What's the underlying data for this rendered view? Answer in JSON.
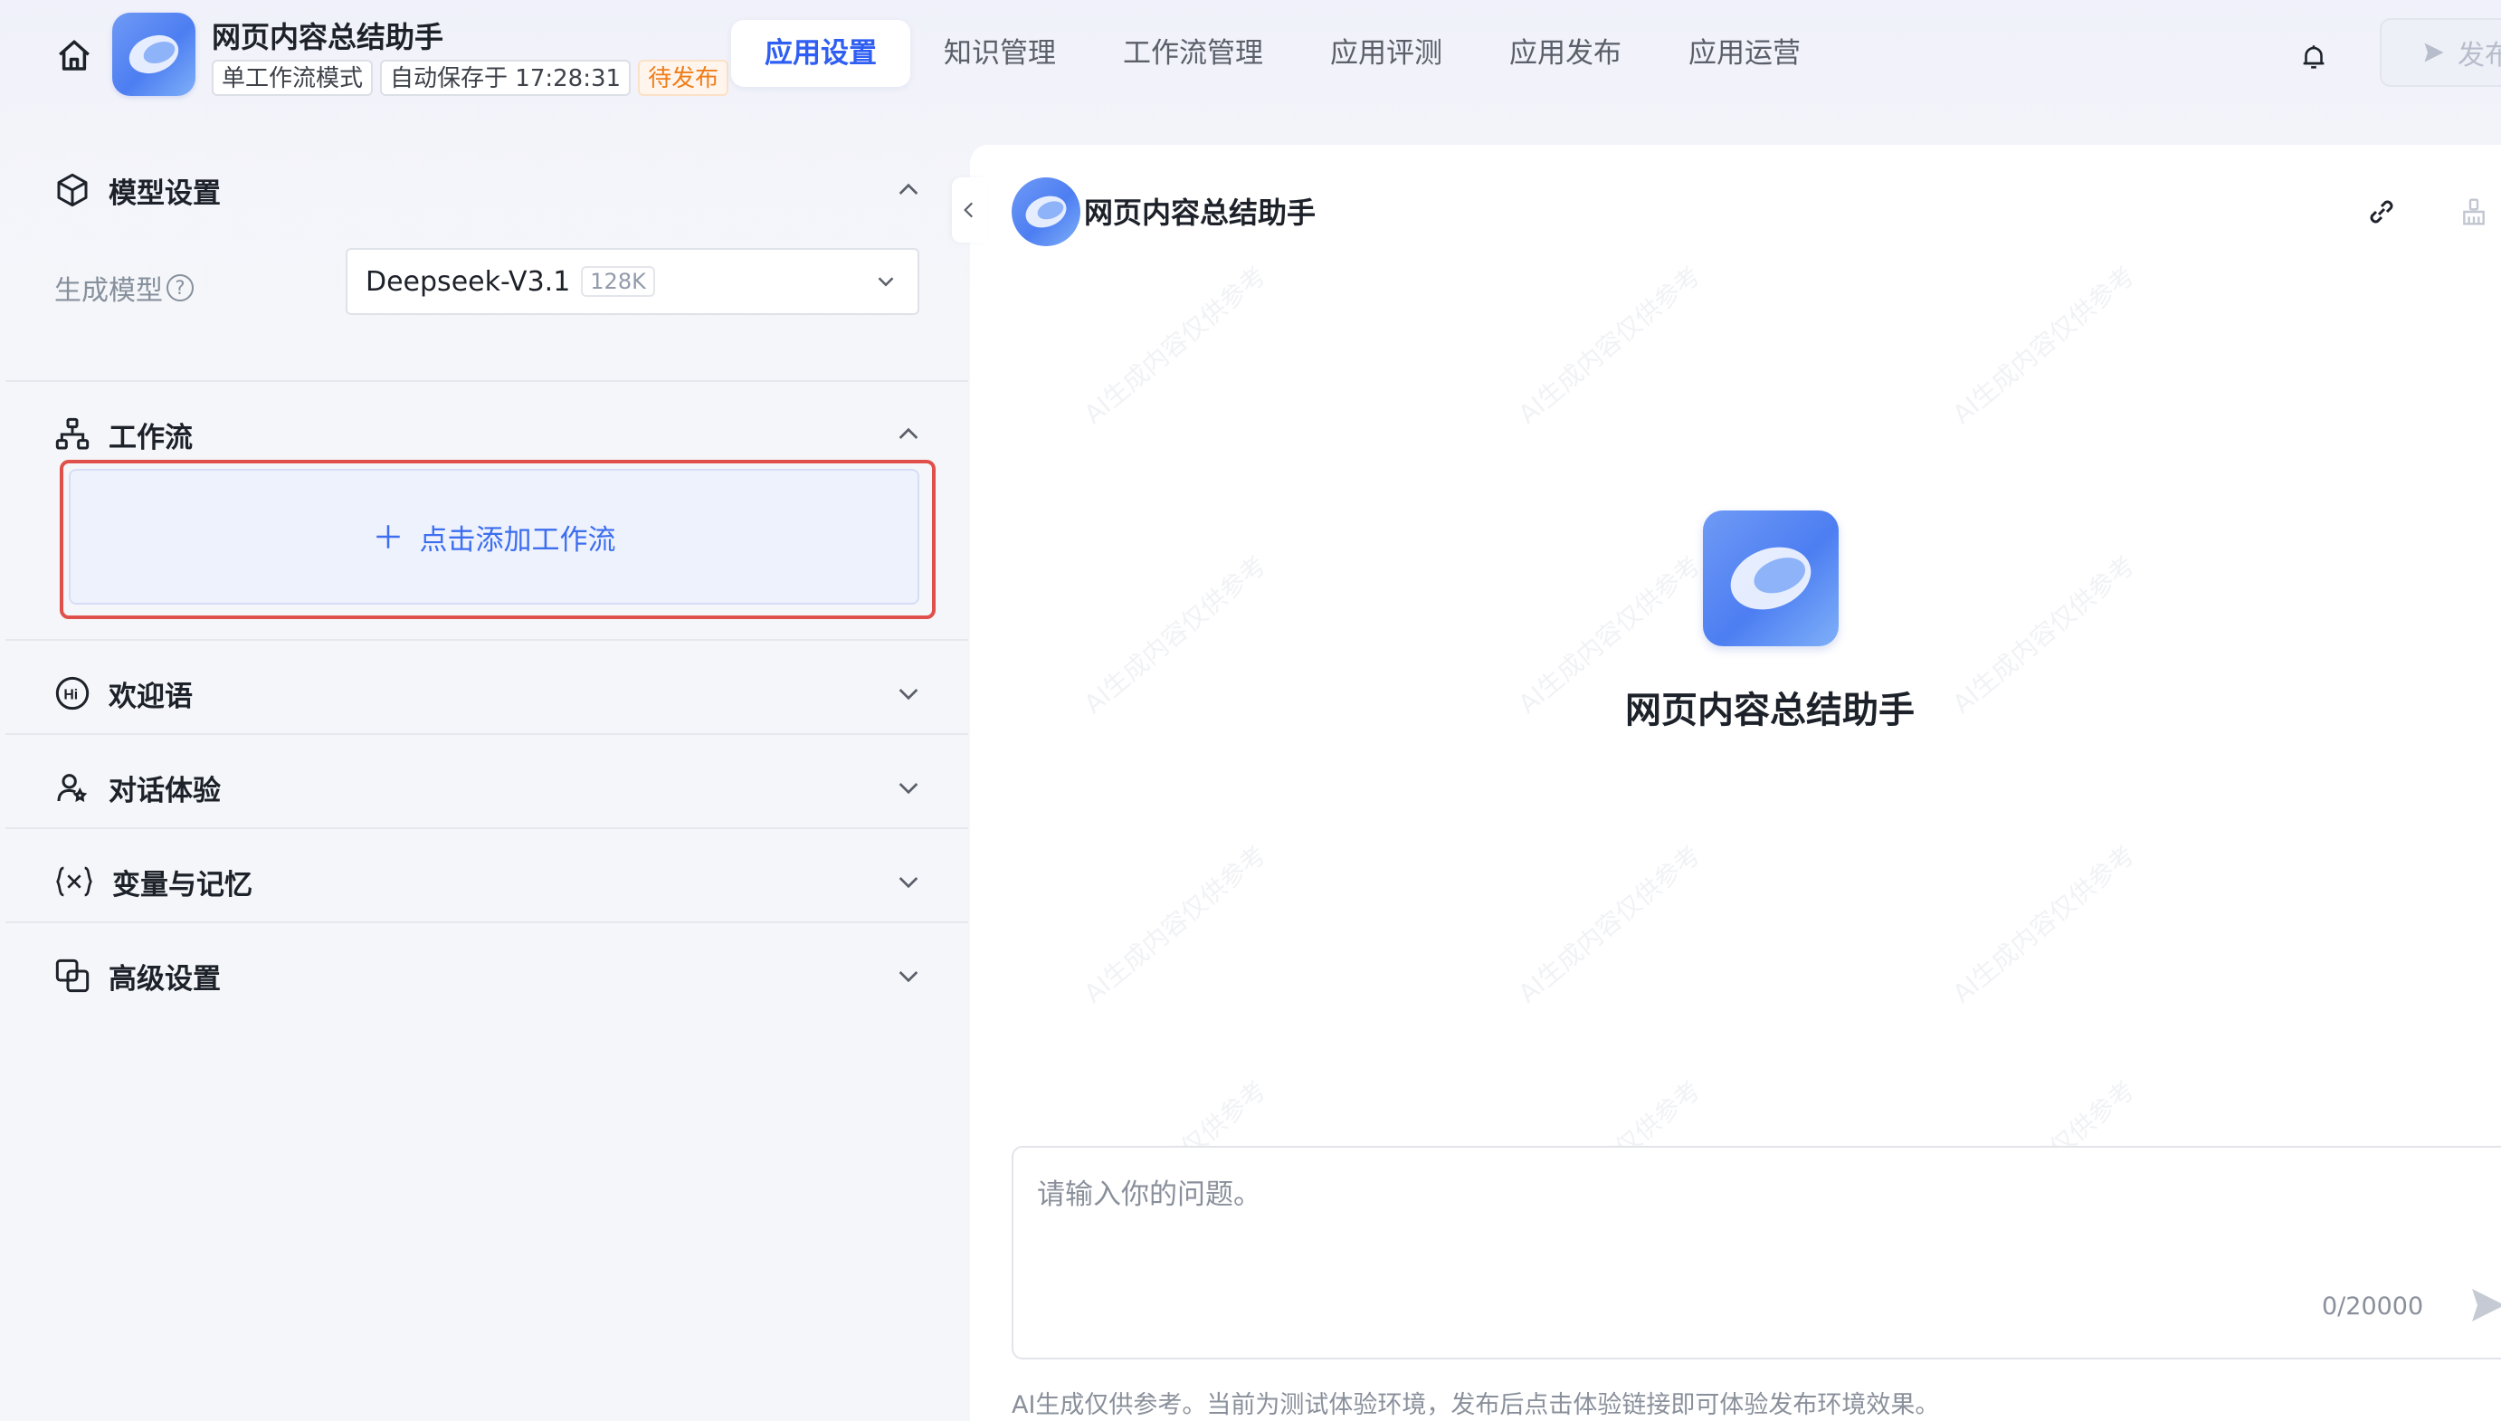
{
  "header": {
    "app_name": "网页内容总结助手",
    "tags": {
      "mode": "单工作流模式",
      "autosave": "自动保存于 17:28:31",
      "status": "待发布"
    },
    "nav_tabs": [
      "应用设置",
      "知识管理",
      "工作流管理",
      "应用评测",
      "应用发布",
      "应用运营"
    ],
    "active_tab": "应用设置",
    "publish_label": "发布"
  },
  "left": {
    "model_section": {
      "title": "模型设置",
      "gen_model_label": "生成模型",
      "help_glyph": "?",
      "model_name": "Deepseek-V3.1",
      "context": "128K"
    },
    "workflow_section": {
      "title": "工作流",
      "add_label": "点击添加工作流"
    },
    "sections": [
      {
        "title": "欢迎语",
        "icon": "hi-icon"
      },
      {
        "title": "对话体验",
        "icon": "user-chat-icon"
      },
      {
        "title": "变量与记忆",
        "icon": "variable-icon"
      },
      {
        "title": "高级设置",
        "icon": "advanced-icon"
      }
    ]
  },
  "right": {
    "title": "网页内容总结助手",
    "center_name": "网页内容总结助手",
    "input_placeholder": "请输入你的问题。",
    "counter": "0/20000",
    "disclaimer": "AI生成仅供参考。当前为测试体验环境，发布后点击体验链接即可体验发布环境效果。",
    "watermark": "AI生成内容仅供参考"
  },
  "colors": {
    "accent": "#2f5ef2",
    "pending": "#f07d1a",
    "highlight_border": "#e0504a"
  }
}
